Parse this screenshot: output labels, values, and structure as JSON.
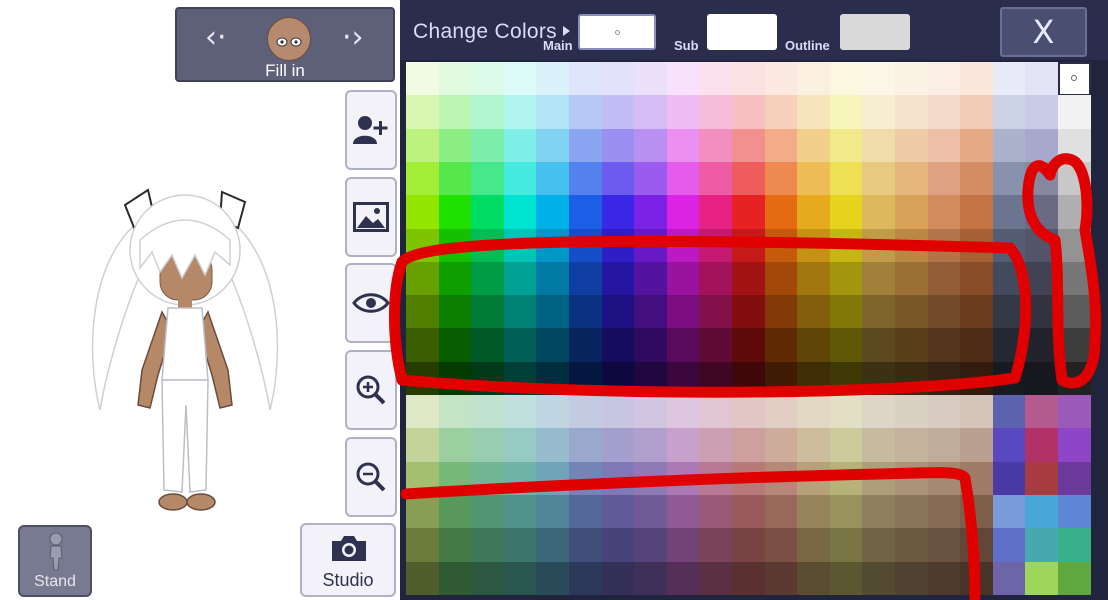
{
  "fill_panel": {
    "label": "Fill in"
  },
  "side_buttons": [
    {
      "name": "add-character-button",
      "icon": "add-person-icon"
    },
    {
      "name": "background-button",
      "icon": "image-icon"
    },
    {
      "name": "visibility-button",
      "icon": "eye-icon"
    },
    {
      "name": "zoom-in-button",
      "icon": "zoom-in-icon"
    },
    {
      "name": "zoom-out-button",
      "icon": "zoom-out-icon"
    }
  ],
  "stand_button": {
    "label": "Stand",
    "icon": "person-standing-icon"
  },
  "studio_button": {
    "label": "Studio",
    "icon": "camera-icon"
  },
  "color_panel": {
    "title": "Change Colors",
    "main_label": "Main",
    "sub_label": "Sub",
    "outline_label": "Outline",
    "main_color": "#ffffff",
    "sub_color": "#ffffff",
    "outline_color": "#d9d9d9",
    "close_label": "X"
  },
  "palette": [
    [
      "#f1fbe2",
      "#e2fbe0",
      "#dcfbe8",
      "#dcfbf8",
      "#dcf2fb",
      "#dfe6fb",
      "#e4e1fb",
      "#ece1fb",
      "#f8e1fb",
      "#fbe1ee",
      "#fbe2e2",
      "#fbe8e0",
      "#fbf0e0",
      "#fbf8e0",
      "#fbf6e8",
      "#fbf1e4",
      "#fbeee4",
      "#fbe8dc",
      "#e9ecf8",
      "#e4e4f6",
      "#ffffff"
    ],
    [
      "#d9f7b2",
      "#bdf5b5",
      "#b0f5d0",
      "#b1f5ef",
      "#b2e4f7",
      "#b7c8f7",
      "#c2bcf7",
      "#d4bdf7",
      "#f0bcf5",
      "#f7bcd9",
      "#f7bfbf",
      "#f7d0bc",
      "#f7e3bc",
      "#f7f4bc",
      "#f6edd2",
      "#f6e3ce",
      "#f4dacb",
      "#f1cbb4",
      "#cdd3e6",
      "#cacbe6",
      "#f2f2f2"
    ],
    [
      "#bdf27e",
      "#8cef84",
      "#7deeac",
      "#7ff0e7",
      "#80d4f2",
      "#8aa6f2",
      "#9b90f2",
      "#b98ff2",
      "#eb8ff0",
      "#f28fbe",
      "#f28f8f",
      "#f2ad88",
      "#f2d08a",
      "#f2ea8a",
      "#f0dcab",
      "#efcca7",
      "#ebc0a6",
      "#e6a985",
      "#aab3cb",
      "#a8a8cc",
      "#e0e0e0"
    ],
    [
      "#a2ee36",
      "#56e84a",
      "#45e88a",
      "#46ebdf",
      "#46c0ee",
      "#5382ee",
      "#6c5cee",
      "#9a5bee",
      "#e55cec",
      "#ee5ca6",
      "#ee5c5c",
      "#ee8a50",
      "#eebd55",
      "#eee055",
      "#e8c980",
      "#e5b67e",
      "#dea280",
      "#d48c62",
      "#8992ad",
      "#87879f",
      "#c8c8c8"
    ],
    [
      "#94e600",
      "#1fe000",
      "#00dd64",
      "#00e4d3",
      "#00b0e6",
      "#1c5ee6",
      "#3a28e6",
      "#7a22e6",
      "#dc22e2",
      "#e62285",
      "#e62222",
      "#e66a12",
      "#e6ab1c",
      "#e6d41c",
      "#ddb85c",
      "#d9a258",
      "#d08c5c",
      "#c47444",
      "#6c7590",
      "#6a6a84",
      "#afafaf"
    ],
    [
      "#7ec400",
      "#15c000",
      "#00be55",
      "#00c4b5",
      "#0096c6",
      "#154ec6",
      "#2f1ec6",
      "#6719c6",
      "#bc19c2",
      "#c61971",
      "#c61919",
      "#c65a0c",
      "#c69214",
      "#c6b614",
      "#c09c48",
      "#bb8844",
      "#b27448",
      "#a66034",
      "#555d75",
      "#53536a",
      "#939393"
    ],
    [
      "#67a000",
      "#0f9e00",
      "#009c45",
      "#00a194",
      "#007aa2",
      "#0f3fa2",
      "#2516a2",
      "#54139f",
      "#9a139e",
      "#a2135c",
      "#a21313",
      "#a2490a",
      "#a2770f",
      "#a2960f",
      "#a08038",
      "#9b6f35",
      "#925e38",
      "#884d28",
      "#434a5e",
      "#424255",
      "#777777"
    ],
    [
      "#518000",
      "#0a7e00",
      "#007c36",
      "#008176",
      "#006282",
      "#0a3282",
      "#1d1082",
      "#430e80",
      "#7b0e7e",
      "#82104a",
      "#820e0e",
      "#823a06",
      "#825f0a",
      "#82780a",
      "#7f652a",
      "#7b5828",
      "#734a2a",
      "#6b3c1e",
      "#333847",
      "#323240",
      "#5c5c5c"
    ],
    [
      "#3b5e00",
      "#075c00",
      "#005a27",
      "#005f56",
      "#00475f",
      "#07245f",
      "#150b5f",
      "#300a5e",
      "#5a0a5c",
      "#5f0b36",
      "#5f0a0a",
      "#5f2a04",
      "#5f4507",
      "#5f5807",
      "#5c4a1e",
      "#59401c",
      "#53351e",
      "#4e2b15",
      "#242833",
      "#23232e",
      "#3d3d3d"
    ],
    [
      "#263d00",
      "#043c00",
      "#003a19",
      "#003e38",
      "#002e3e",
      "#041740",
      "#0e0740",
      "#20073f",
      "#3b073d",
      "#3f0724",
      "#3f0707",
      "#3f1c03",
      "#3f2e05",
      "#3f3a05",
      "#3d3114",
      "#3b2a12",
      "#372314",
      "#331c0e",
      "#171a21",
      "#17171e",
      "#222222"
    ],
    [
      "#dfe8c4",
      "#c4e4c6",
      "#c0e2cf",
      "#bfe0dc",
      "#bfd6e2",
      "#c2cbe2",
      "#c8c5e2",
      "#d1c5e2",
      "#dec5e0",
      "#e2c5d2",
      "#e2c6c6",
      "#e2cec4",
      "#e2d8c4",
      "#e2e0c4",
      "#ddd6c6",
      "#dbd0c4",
      "#d8cbc2",
      "#d4c3b8",
      "#5c62ae",
      "#b45a8e",
      "#9c5ab8"
    ],
    [
      "#c2d49a",
      "#9ccf9f",
      "#98cdb0",
      "#96cbc3",
      "#96bccd",
      "#9aa8cd",
      "#a49fcd",
      "#b19fcd",
      "#c7a0cb",
      "#cd9fb3",
      "#cd9f9f",
      "#cdac9c",
      "#cdbd9c",
      "#cdca9c",
      "#c6bb9f",
      "#c3b39c",
      "#bfac99",
      "#b9a08f",
      "#5a48c0",
      "#b23268",
      "#8e45c8"
    ],
    [
      "#a5bf70",
      "#76b979",
      "#71b692",
      "#6fb4a9",
      "#6fa3b7",
      "#7385b7",
      "#7f79b7",
      "#9079b7",
      "#ac79b4",
      "#b779949",
      "#b77979",
      "#b7887a",
      "#b7a07a",
      "#b7b27a",
      "#ae9e7a",
      "#aa9377",
      "#a58a73",
      "#9e7c68",
      "#4a3aa6",
      "#a83c42",
      "#6b3a9a"
    ],
    [
      "#889e52",
      "#58985b",
      "#529574",
      "#50938a",
      "#508698",
      "#54699a",
      "#605a98",
      "#705a98",
      "#8f5a95",
      "#985a76",
      "#985a5a",
      "#986a5c",
      "#98845c",
      "#98935c",
      "#8e805c",
      "#8b755a",
      "#876c56",
      "#7f5e4c",
      "#7a9ad8",
      "#4aa6d8",
      "#5e86d6"
    ],
    [
      "#6b7d3d",
      "#437a45",
      "#3e7758",
      "#3c756c",
      "#3c687a",
      "#3f4f7a",
      "#48437a",
      "#56437a",
      "#724377",
      "#7a435a",
      "#7a4343",
      "#7a5045",
      "#7a6845",
      "#7a7545",
      "#706445",
      "#6d5a43",
      "#695240",
      "#624638",
      "#6070c8",
      "#48a8b0",
      "#3ab08a"
    ],
    [
      "#4f5c2c",
      "#305a32",
      "#2c5841",
      "#2a5650",
      "#2a4b5a",
      "#2d395a",
      "#34305a",
      "#3f305a",
      "#552f58",
      "#5a3042",
      "#5a3030",
      "#5a3a31",
      "#5a4c31",
      "#5a5731",
      "#524a31",
      "#504230",
      "#4d3c2e",
      "#473328",
      "#6e64a8",
      "#9ed65c",
      "#5ea83e"
    ]
  ]
}
